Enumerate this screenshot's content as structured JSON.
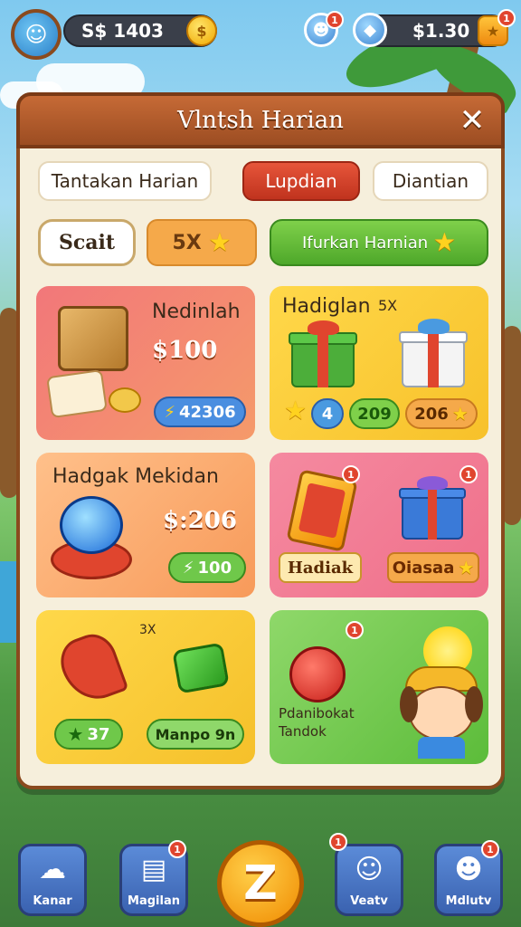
{
  "hud": {
    "left_value": "S$ 1403",
    "right_value": "$1.30",
    "left_badge": "1",
    "right_badge": "1"
  },
  "modal": {
    "title": "Vlntsh Harian",
    "tabs": [
      {
        "label": "Tantakan Harian",
        "active": false
      },
      {
        "label": "Lupdian",
        "active": true
      },
      {
        "label": "Diantian",
        "active": false
      }
    ],
    "speech_label": "Scait",
    "orange_chip": "5X",
    "green_button": "Ifurkan Harnian"
  },
  "cards": {
    "c1": {
      "title": "Nedinlah",
      "price": "$100",
      "pill": "42306"
    },
    "c2": {
      "title": "Hadiglan",
      "tag": "5X",
      "pill_a": "4",
      "pill_b": "209",
      "pill_c": "206"
    },
    "c3": {
      "title": "Hadgak Mekidan",
      "price": "$:206",
      "pill": "100"
    },
    "c4": {
      "badge_a": "1",
      "badge_b": "1",
      "label_a": "Hadiak",
      "label_b": "Oiasaa"
    },
    "c5": {
      "tag": "3X",
      "pill_a": "37",
      "pill_b": "Manpo 9n"
    },
    "c6": {
      "badge": "1",
      "label_line1": "Pdanibokat",
      "label_line2": "Tandok"
    }
  },
  "nav": {
    "items": [
      {
        "label": "Kanar",
        "badge": ""
      },
      {
        "label": "Magilan",
        "badge": "1"
      },
      {
        "label": "Veatv",
        "badge": "1"
      },
      {
        "label": "Mdlutv",
        "badge": "1"
      }
    ],
    "center_label": "Z"
  },
  "colors": {
    "modal_bg": "#f6efdc",
    "header": "#b85a2c",
    "active_tab": "#d8442a",
    "green": "#5cb82e"
  }
}
